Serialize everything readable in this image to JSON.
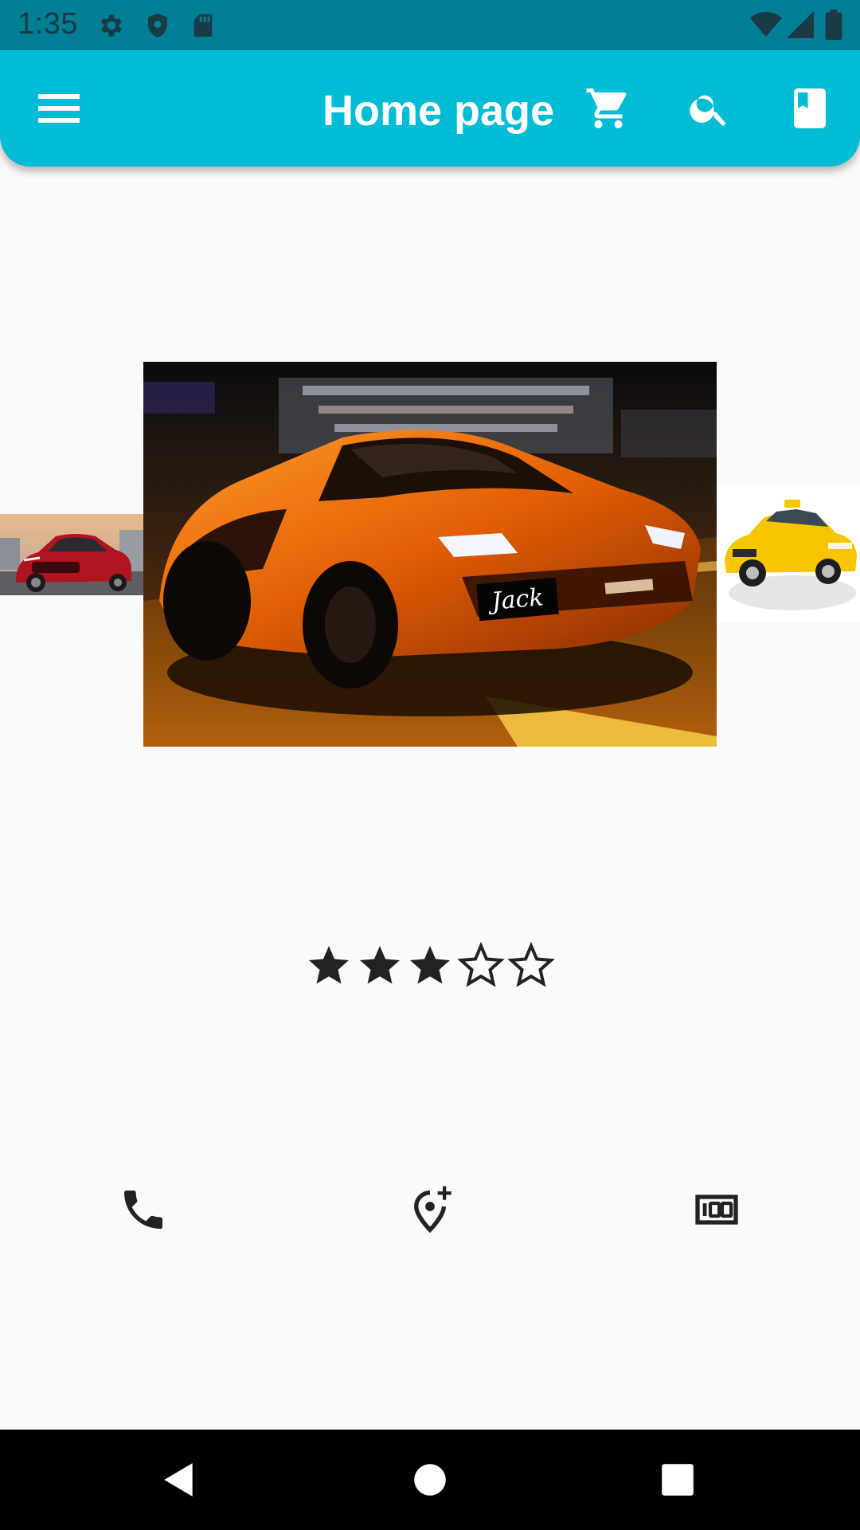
{
  "status_bar": {
    "time": "1:35",
    "left_icons": [
      "gear-icon",
      "shield-icon",
      "sd-card-icon"
    ],
    "right_icons": [
      "wifi-icon",
      "signal-icon",
      "battery-icon"
    ]
  },
  "app_bar": {
    "title": "Home page",
    "background_color": "#00bcd4",
    "icons": [
      "menu-icon",
      "cart-icon",
      "search-icon",
      "book-icon"
    ]
  },
  "carousel": {
    "slides": [
      {
        "position": "previous",
        "description": "red sedan"
      },
      {
        "position": "current",
        "description": "orange sports car",
        "plate_text": "Jack"
      },
      {
        "position": "next",
        "description": "yellow taxi"
      }
    ]
  },
  "rating": {
    "value": 3,
    "max": 5
  },
  "actions": [
    "phone-icon",
    "add-location-icon",
    "hundred-icon"
  ],
  "nav_bar": {
    "buttons": [
      "back-icon",
      "home-icon",
      "recents-icon"
    ]
  }
}
